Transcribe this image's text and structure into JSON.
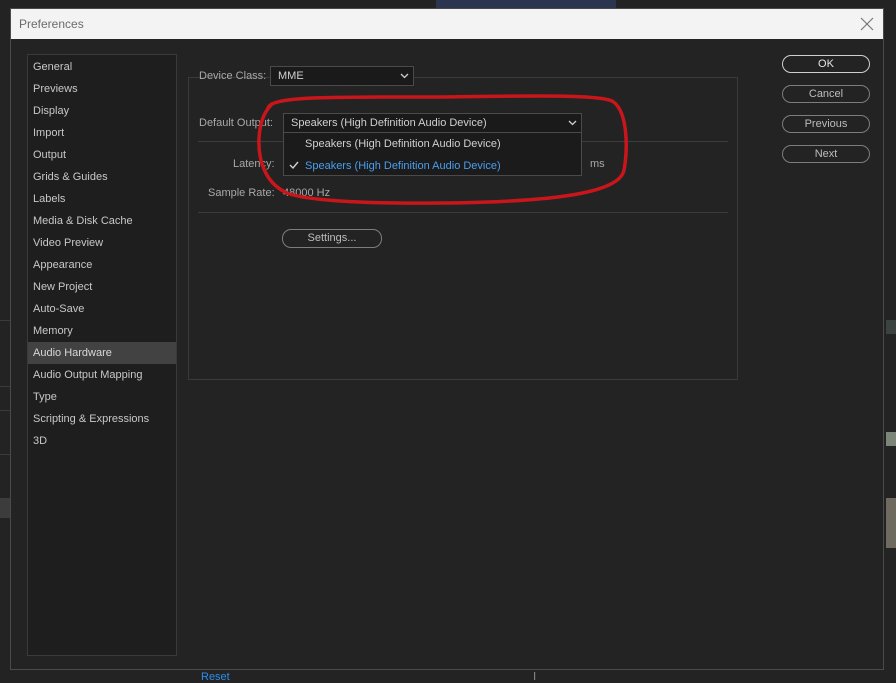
{
  "dialog": {
    "title": "Preferences"
  },
  "sidebar": {
    "items": [
      {
        "label": "General"
      },
      {
        "label": "Previews"
      },
      {
        "label": "Display"
      },
      {
        "label": "Import"
      },
      {
        "label": "Output"
      },
      {
        "label": "Grids & Guides"
      },
      {
        "label": "Labels"
      },
      {
        "label": "Media & Disk Cache"
      },
      {
        "label": "Video Preview"
      },
      {
        "label": "Appearance"
      },
      {
        "label": "New Project"
      },
      {
        "label": "Auto-Save"
      },
      {
        "label": "Memory"
      },
      {
        "label": "Audio Hardware",
        "active": true
      },
      {
        "label": "Audio Output Mapping"
      },
      {
        "label": "Type"
      },
      {
        "label": "Scripting & Expressions"
      },
      {
        "label": "3D"
      }
    ]
  },
  "audio": {
    "device_class_label": "Device Class:",
    "device_class_value": "MME",
    "default_output_label": "Default Output:",
    "default_output_value": "Speakers (High Definition Audio Device)",
    "output_options": [
      {
        "label": "Speakers (High Definition Audio Device)",
        "selected": false
      },
      {
        "label": "Speakers (High Definition Audio Device)",
        "selected": true
      }
    ],
    "latency_label": "Latency:",
    "latency_unit": "ms",
    "sample_rate_label": "Sample Rate:",
    "sample_rate_value": "48000 Hz",
    "settings_button": "Settings..."
  },
  "buttons": {
    "ok": "OK",
    "cancel": "Cancel",
    "previous": "Previous",
    "next": "Next"
  },
  "background": {
    "reset_link": "Reset"
  },
  "colors": {
    "accent_blue": "#4a9eef",
    "annotation_red": "#c8161b",
    "selected_item_bg": "#424242"
  }
}
